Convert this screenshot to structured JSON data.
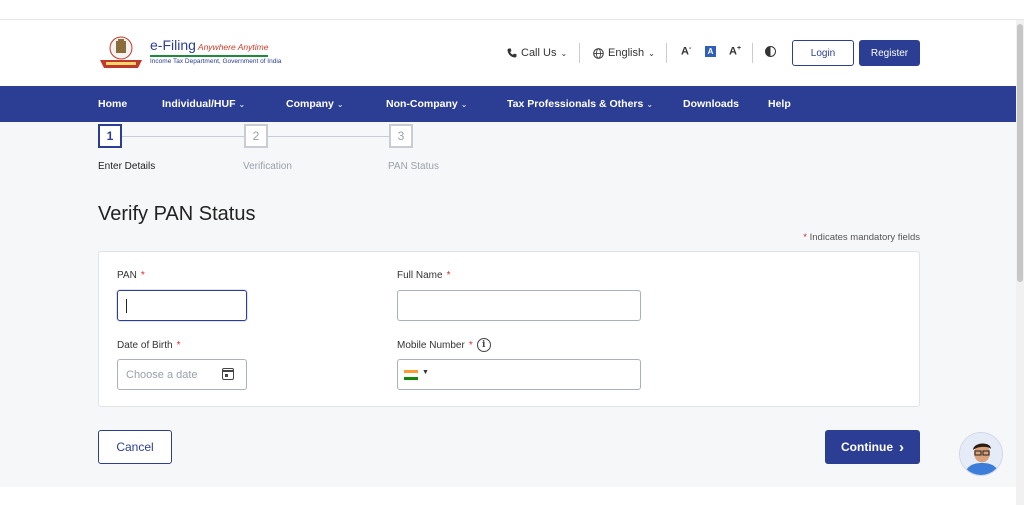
{
  "header": {
    "logo_title": "e-Filing",
    "logo_tagline": "Anywhere Anytime",
    "logo_subtitle": "Income Tax Department, Government of India",
    "call_us": "Call Us",
    "language": "English",
    "font_decrease": "A",
    "font_default": "A",
    "font_increase": "A",
    "login": "Login",
    "register": "Register"
  },
  "nav": {
    "items": [
      {
        "label": "Home",
        "dropdown": false
      },
      {
        "label": "Individual/HUF",
        "dropdown": true
      },
      {
        "label": "Company",
        "dropdown": true
      },
      {
        "label": "Non-Company",
        "dropdown": true
      },
      {
        "label": "Tax Professionals & Others",
        "dropdown": true
      },
      {
        "label": "Downloads",
        "dropdown": false
      },
      {
        "label": "Help",
        "dropdown": false
      }
    ]
  },
  "stepper": {
    "steps": [
      {
        "number": "1",
        "label": "Enter Details",
        "active": true
      },
      {
        "number": "2",
        "label": "Verification",
        "active": false
      },
      {
        "number": "3",
        "label": "PAN Status",
        "active": false
      }
    ]
  },
  "page": {
    "title": "Verify PAN Status",
    "mandatory_star": "*",
    "mandatory_note": "Indicates mandatory fields"
  },
  "form": {
    "pan_label": "PAN",
    "pan_value": "",
    "full_name_label": "Full Name",
    "full_name_value": "",
    "dob_label": "Date of Birth",
    "dob_placeholder": "Choose a date",
    "mobile_label": "Mobile Number",
    "mobile_value": "",
    "required_mark": "*"
  },
  "actions": {
    "cancel": "Cancel",
    "continue": "Continue",
    "continue_icon": "›"
  },
  "colors": {
    "primary": "#2c3e93",
    "required": "#d32f2f",
    "page_bg": "#f6f7f9"
  },
  "icons": [
    "phone-icon",
    "globe-icon",
    "chevron-down-icon",
    "contrast-icon",
    "calendar-icon",
    "info-icon",
    "india-flag-icon",
    "chatbot-avatar-icon"
  ]
}
